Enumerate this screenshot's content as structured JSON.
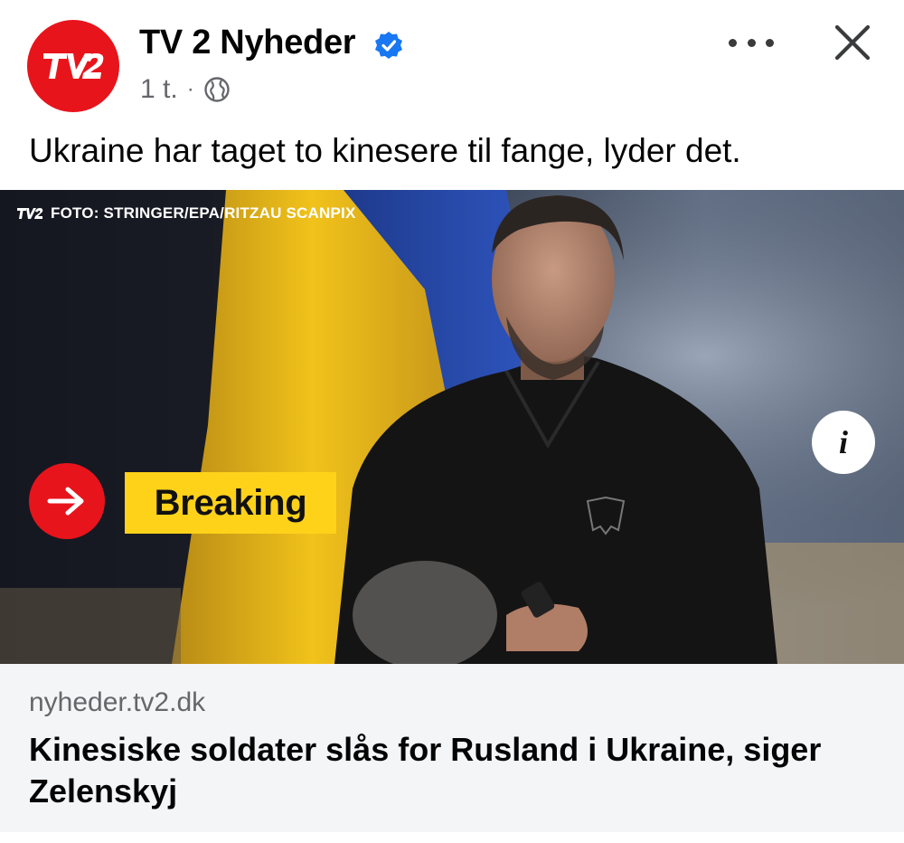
{
  "post": {
    "page_name": "TV 2 Nyheder",
    "verified": true,
    "timestamp": "1 t.",
    "separator": "·",
    "audience_icon": "globe-icon",
    "more_icon": "more-options-icon",
    "close_icon": "close-icon",
    "text": "Ukraine har taget to kinesere til fange, lyder det."
  },
  "media": {
    "logo_text": "TV2",
    "photo_credit": "FOTO: STRINGER/EPA/RITZAU SCANPIX",
    "info_label": "i",
    "breaking_label": "Breaking",
    "breaking_icon": "arrow-right-icon"
  },
  "link": {
    "domain": "nyheder.tv2.dk",
    "title": "Kinesiske soldater slås for Rusland i Ukraine, siger Zelenskyj"
  },
  "colors": {
    "brand_red": "#e8141c",
    "verified_blue": "#1877f2",
    "breaking_yellow": "#ffd21a",
    "preview_bg": "#f4f5f7"
  }
}
